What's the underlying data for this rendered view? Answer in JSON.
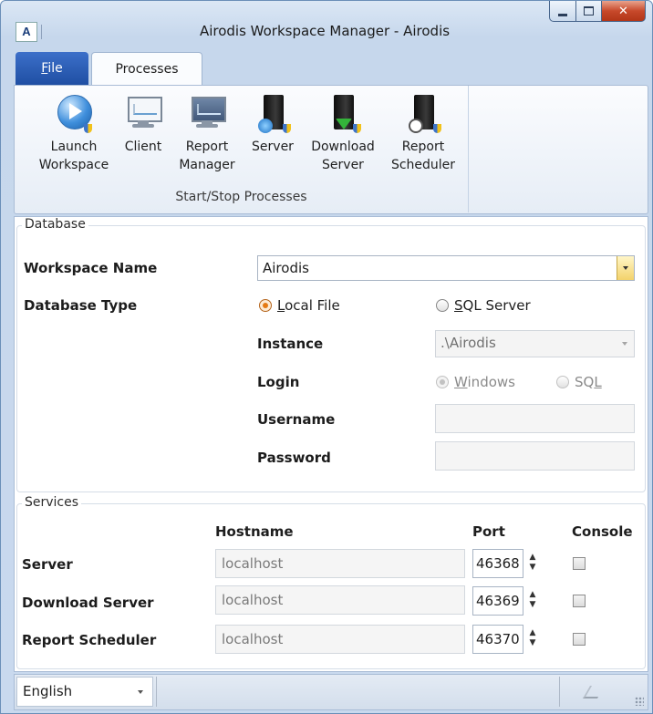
{
  "window": {
    "title": "Airodis Workspace Manager - Airodis",
    "logo": "A",
    "controls": {
      "minimize": "minimize-icon",
      "maximize": "maximize-icon",
      "close": "close-icon"
    }
  },
  "ribbon": {
    "tabs": [
      {
        "label": "File",
        "active": false,
        "accent": "#2557ad"
      },
      {
        "label": "Processes",
        "active": true
      }
    ],
    "group": {
      "label": "Start/Stop Processes",
      "buttons": [
        {
          "line1": "Launch",
          "line2": "Workspace",
          "icon": "play-icon"
        },
        {
          "line1": "Client",
          "line2": "",
          "icon": "monitor-icon"
        },
        {
          "line1": "Report",
          "line2": "Manager",
          "icon": "report-monitor-icon"
        },
        {
          "line1": "Server",
          "line2": "",
          "icon": "server-sync-icon"
        },
        {
          "line1": "Download",
          "line2": "Server",
          "icon": "server-download-icon"
        },
        {
          "line1": "Report",
          "line2": "Scheduler",
          "icon": "server-clock-icon"
        }
      ]
    }
  },
  "database": {
    "legend": "Database",
    "workspace_name_label": "Workspace Name",
    "workspace_name_value": "Airodis",
    "database_type_label": "Database Type",
    "local_file_label": "Local File",
    "sql_server_label": "SQL Server",
    "database_type_selected": "Local File",
    "instance_label": "Instance",
    "instance_value": ".\\Airodis",
    "login_label": "Login",
    "login_windows_label": "Windows",
    "login_sql_label": "SQL",
    "login_selected": "Windows",
    "username_label": "Username",
    "username_value": "",
    "password_label": "Password",
    "password_value": ""
  },
  "services": {
    "legend": "Services",
    "headers": {
      "hostname": "Hostname",
      "port": "Port",
      "console": "Console"
    },
    "rows": [
      {
        "name": "Server",
        "hostname": "localhost",
        "port": "46368",
        "console": false
      },
      {
        "name": "Download Server",
        "hostname": "localhost",
        "port": "46369",
        "console": false
      },
      {
        "name": "Report Scheduler",
        "hostname": "localhost",
        "port": "46370",
        "console": false
      }
    ]
  },
  "statusbar": {
    "language": "English"
  },
  "colors": {
    "file_tab": "#2557ad",
    "radio_selected": "#e57a14",
    "combo_drop": "#f3d26b"
  }
}
